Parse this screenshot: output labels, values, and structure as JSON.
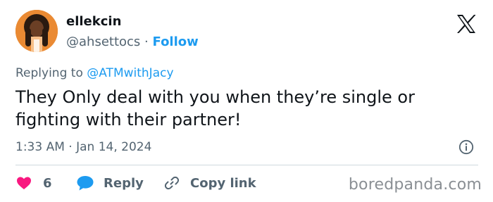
{
  "author": {
    "display_name": "ellekcin",
    "handle": "@ahsettocs",
    "separator": "·",
    "follow_label": "Follow"
  },
  "reply_context": {
    "prefix": "Replying to",
    "mention": "@ATMwithJacy"
  },
  "tweet": {
    "text": "They Only deal with you when they’re single or fighting with their partner!",
    "timestamp": "1:33 AM · Jan 14, 2024"
  },
  "actions": {
    "like_count": "6",
    "reply_label": "Reply",
    "copy_link_label": "Copy link"
  },
  "watermark": "boredpanda.com",
  "icons": {
    "brand": "x-logo-icon",
    "info": "info-icon",
    "like": "heart-icon",
    "reply": "speech-bubble-icon",
    "copy_link": "link-icon"
  },
  "colors": {
    "like": "#f91880",
    "reply": "#1d9bf0",
    "follow": "#1d9bf0",
    "secondary_text": "#536471"
  }
}
